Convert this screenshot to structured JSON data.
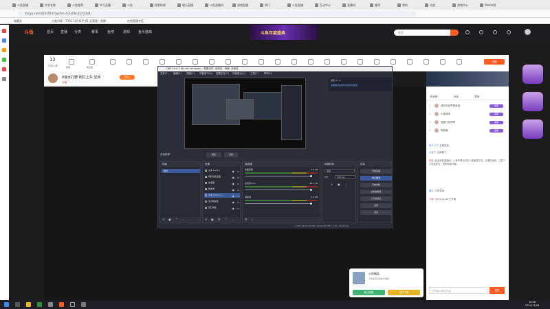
{
  "browser": {
    "tabs": [
      "斗鱼直播",
      "中文名称",
      "斗鱼推荐",
      "学习直播",
      "斗鱼",
      "搜索结果",
      "娱乐直播",
      "斗鱼直播间",
      "游戏直播",
      "热门",
      "斗鱼直播",
      "互动中心",
      "直播间",
      "推荐",
      "我的",
      "动态",
      "游戏中心",
      "Web浏览"
    ],
    "address": "douyu.com/4222914?dyshid=0-2a0bcd-2103e4...",
    "bookmarks": [
      "收藏夹",
      "分类列表 - 7361 1列 知乎 JIS",
      "云管理 - 直播",
      "在线直播专区"
    ]
  },
  "douyu": {
    "logo": "斗鱼",
    "nav": [
      "首页",
      "直播",
      "分类",
      "赛事",
      "鱼吧",
      "游戏",
      "鱼乐盛典"
    ],
    "banner": "斗鱼年度盛典",
    "search_placeholder": "搜索",
    "online_count": "12",
    "online_label": "在线人数",
    "tools": [
      "贵族",
      "粉丝团",
      "",
      "",
      "",
      "",
      "",
      "",
      "",
      "",
      "",
      "",
      "",
      "",
      "",
      "",
      "",
      "",
      "",
      "",
      ""
    ],
    "recharge": "充值",
    "room_title": "0浪太打野 刷打上车 空间",
    "follow_label": "关注",
    "tag": "主播"
  },
  "obs": {
    "title": "OBS 29.0.3 (64-bit, windows) - 配置文件: 未命名 - 场景: 未命名",
    "menu": [
      "文件(F)",
      "编辑(E)",
      "视图(V)",
      "停靠窗口(D)",
      "配置文件(P)",
      "场景集合(S)",
      "工具(T)",
      "帮助(H)"
    ],
    "notice_title": "通知 2.1.0",
    "notice_text": "直播推流设置将自动优化配置",
    "scene_label": "未选择源",
    "scene_buttons": [
      "属性",
      "滤镜"
    ],
    "docks": {
      "scenes": "场景",
      "sources": "来源",
      "mixer": "混音器",
      "transitions": "转场特效",
      "controls": "控件"
    },
    "scene_item": "场景",
    "sources": [
      {
        "name": "文本 (GDI+)",
        "sel": false
      },
      {
        "name": "视频采集设备",
        "sel": false
      },
      {
        "name": "浏览器",
        "sel": false
      },
      {
        "name": "媒体源",
        "sel": false
      },
      {
        "name": "文本 (GDI+) 2",
        "sel": true
      },
      {
        "name": "显示器采集",
        "sel": false
      },
      {
        "name": "窗口采集",
        "sel": false
      }
    ],
    "mixer": [
      {
        "name": "桌面音频",
        "db": "0.0 dB"
      },
      {
        "name": "麦克风/Aux",
        "db": "-18.2 dB"
      },
      {
        "name": "媒体源",
        "db": "0.0 dB"
      }
    ],
    "transition_label": "淡出",
    "duration_label": "时长",
    "duration_value": "300 ms",
    "controls": [
      "开始直播",
      "停止推流",
      "开始录制",
      "虚拟摄像机",
      "工作室模式",
      "设置",
      "退出"
    ],
    "status": "LIVE: 00:00:00   REC: 00:00:00   CPU: 1.2%, 30.00 fps"
  },
  "chat": {
    "tabs": [
      "粉丝榜",
      "贵族",
      "周榜"
    ],
    "rank": [
      {
        "num": "1",
        "name": "我在你世界很浪漫",
        "badge": "贵族"
      },
      {
        "num": "2",
        "name": "小猫咪咪",
        "badge": "贵族"
      },
      {
        "num": "3",
        "name": "我爱打游戏啊",
        "badge": "贵族"
      },
      {
        "num": "4",
        "name": "陈皮糖",
        "badge": "贵族"
      }
    ],
    "messages": [
      {
        "u": "用户123",
        "t": "主播加油!"
      },
      {
        "u": "小鱼干",
        "t": "这局稳了"
      },
      {
        "u": "系统",
        "t": "欢迎来到直播间，斗鱼严禁未成年人直播或打赏。请理性消费，注意个人信息安全，谨防网络诈骗。"
      },
      {
        "u": "路过",
        "t": "打野带我"
      },
      {
        "u": "斗鱼",
        "t": "2024-11-06 已开播"
      }
    ],
    "input_placeholder": "这里输入聊天内容",
    "send": "发送"
  },
  "popup": {
    "title": "火线精英",
    "sub": "下载游戏领取新手福利",
    "btn_left": "前往领取",
    "btn_right": "立即下载"
  },
  "taskbar": {
    "time": "10:26",
    "date": "2024/11/06"
  }
}
